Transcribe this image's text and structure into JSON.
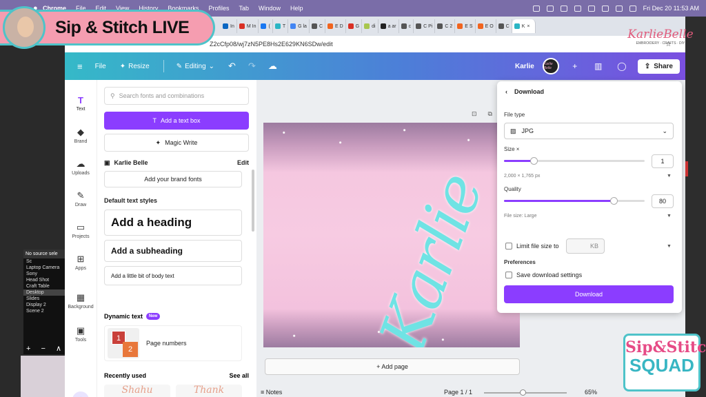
{
  "menubar": {
    "items": [
      "Chrome",
      "File",
      "Edit",
      "View",
      "History",
      "Bookmarks",
      "Profiles",
      "Tab",
      "Window",
      "Help"
    ],
    "clock": "Fri Dec 20  11:53 AM"
  },
  "overlay": {
    "banner_title": "Sip & Stitch LIVE",
    "logo_script": "KarlieBelle",
    "logo_sub": "EMBROIDERY · CRAFTS · DIY",
    "squad_line1": "Sip&Stitch",
    "squad_line2": "SQUAD"
  },
  "obs": {
    "header": "No source sele",
    "sub": "Sc",
    "sources": [
      "Laptop Camera",
      "Sony",
      "Head Shot",
      "Craft Table",
      "Desktop",
      "Slides",
      "Display 2",
      "Scene 2"
    ],
    "selected": "Desktop",
    "controls": "+ − ∧"
  },
  "browser": {
    "tabs": [
      {
        "label": "In",
        "color": "#0a66c2"
      },
      {
        "label": "M In",
        "color": "#d93025"
      },
      {
        "label": "(",
        "color": "#1877f2"
      },
      {
        "label": "T",
        "color": "#2bb5c4"
      },
      {
        "label": "G la",
        "color": "#4285f4"
      },
      {
        "label": "C",
        "color": "#555"
      },
      {
        "label": "E D",
        "color": "#f1641e"
      },
      {
        "label": "G",
        "color": "#d93025"
      },
      {
        "label": "di",
        "color": "#a8c64e"
      },
      {
        "label": "a ar",
        "color": "#222"
      },
      {
        "label": "c",
        "color": "#555"
      },
      {
        "label": "C Pi",
        "color": "#555"
      },
      {
        "label": "C 2",
        "color": "#555"
      },
      {
        "label": "E S",
        "color": "#f1641e"
      },
      {
        "label": "E O",
        "color": "#f1641e"
      },
      {
        "label": "C",
        "color": "#555"
      },
      {
        "label": "K",
        "color": "#2bb5c4"
      }
    ],
    "active_tab": "K",
    "url": "Z2cCfp08/wj7zN5PE8Hs2E629KN6SDw/edit"
  },
  "header": {
    "file": "File",
    "resize": "Resize",
    "editing": "Editing",
    "user": "Karlie",
    "avatar_text": "Karlie Belle",
    "share": "Share"
  },
  "rail": [
    {
      "label": "Text",
      "icon": "T",
      "name": "text"
    },
    {
      "label": "Brand",
      "icon": "◆",
      "name": "brand"
    },
    {
      "label": "Uploads",
      "icon": "☁",
      "name": "uploads"
    },
    {
      "label": "Draw",
      "icon": "✎",
      "name": "draw"
    },
    {
      "label": "Projects",
      "icon": "▭",
      "name": "projects"
    },
    {
      "label": "Apps",
      "icon": "⊞",
      "name": "apps"
    },
    {
      "label": "Background",
      "icon": "▦",
      "name": "background"
    },
    {
      "label": "Tools",
      "icon": "▣",
      "name": "tools"
    }
  ],
  "panel": {
    "search_placeholder": "Search fonts and combinations",
    "add_text_box": "Add a text box",
    "magic_write": "Magic Write",
    "brand_name": "Karlie Belle",
    "edit": "Edit",
    "brand_fonts": "Add your brand fonts",
    "default_styles": "Default text styles",
    "heading": "Add a heading",
    "subheading": "Add a subheading",
    "body": "Add a little bit of body text",
    "dynamic_text": "Dynamic text",
    "new_badge": "New",
    "page_numbers": "Page numbers",
    "thumb_a": "1",
    "thumb_b": "2",
    "recently_used": "Recently used",
    "see_all": "See all",
    "recent_1": "Shahu",
    "recent_2": "Thank"
  },
  "canvas": {
    "design_text": "Karlie",
    "add_page": "+ Add page"
  },
  "footer": {
    "notes": "Notes",
    "page": "Page 1 / 1",
    "zoom": "65%",
    "zoom_fraction": 0.47
  },
  "download": {
    "title": "Download",
    "file_type_label": "File type",
    "file_type": "JPG",
    "size_label": "Size ×",
    "size_value": "1",
    "size_fraction": 0.21,
    "dimensions": "2,000 × 1,765 px",
    "quality_label": "Quality",
    "quality_value": "80",
    "quality_fraction": 0.78,
    "file_size": "File size: Large",
    "limit_label": "Limit file size to",
    "kb": "KB",
    "preferences": "Preferences",
    "save_settings": "Save download settings",
    "button": "Download"
  },
  "colors": {
    "accent": "#8b3dff",
    "header_start": "#35b9c8",
    "header_end": "#7a4fe0"
  }
}
